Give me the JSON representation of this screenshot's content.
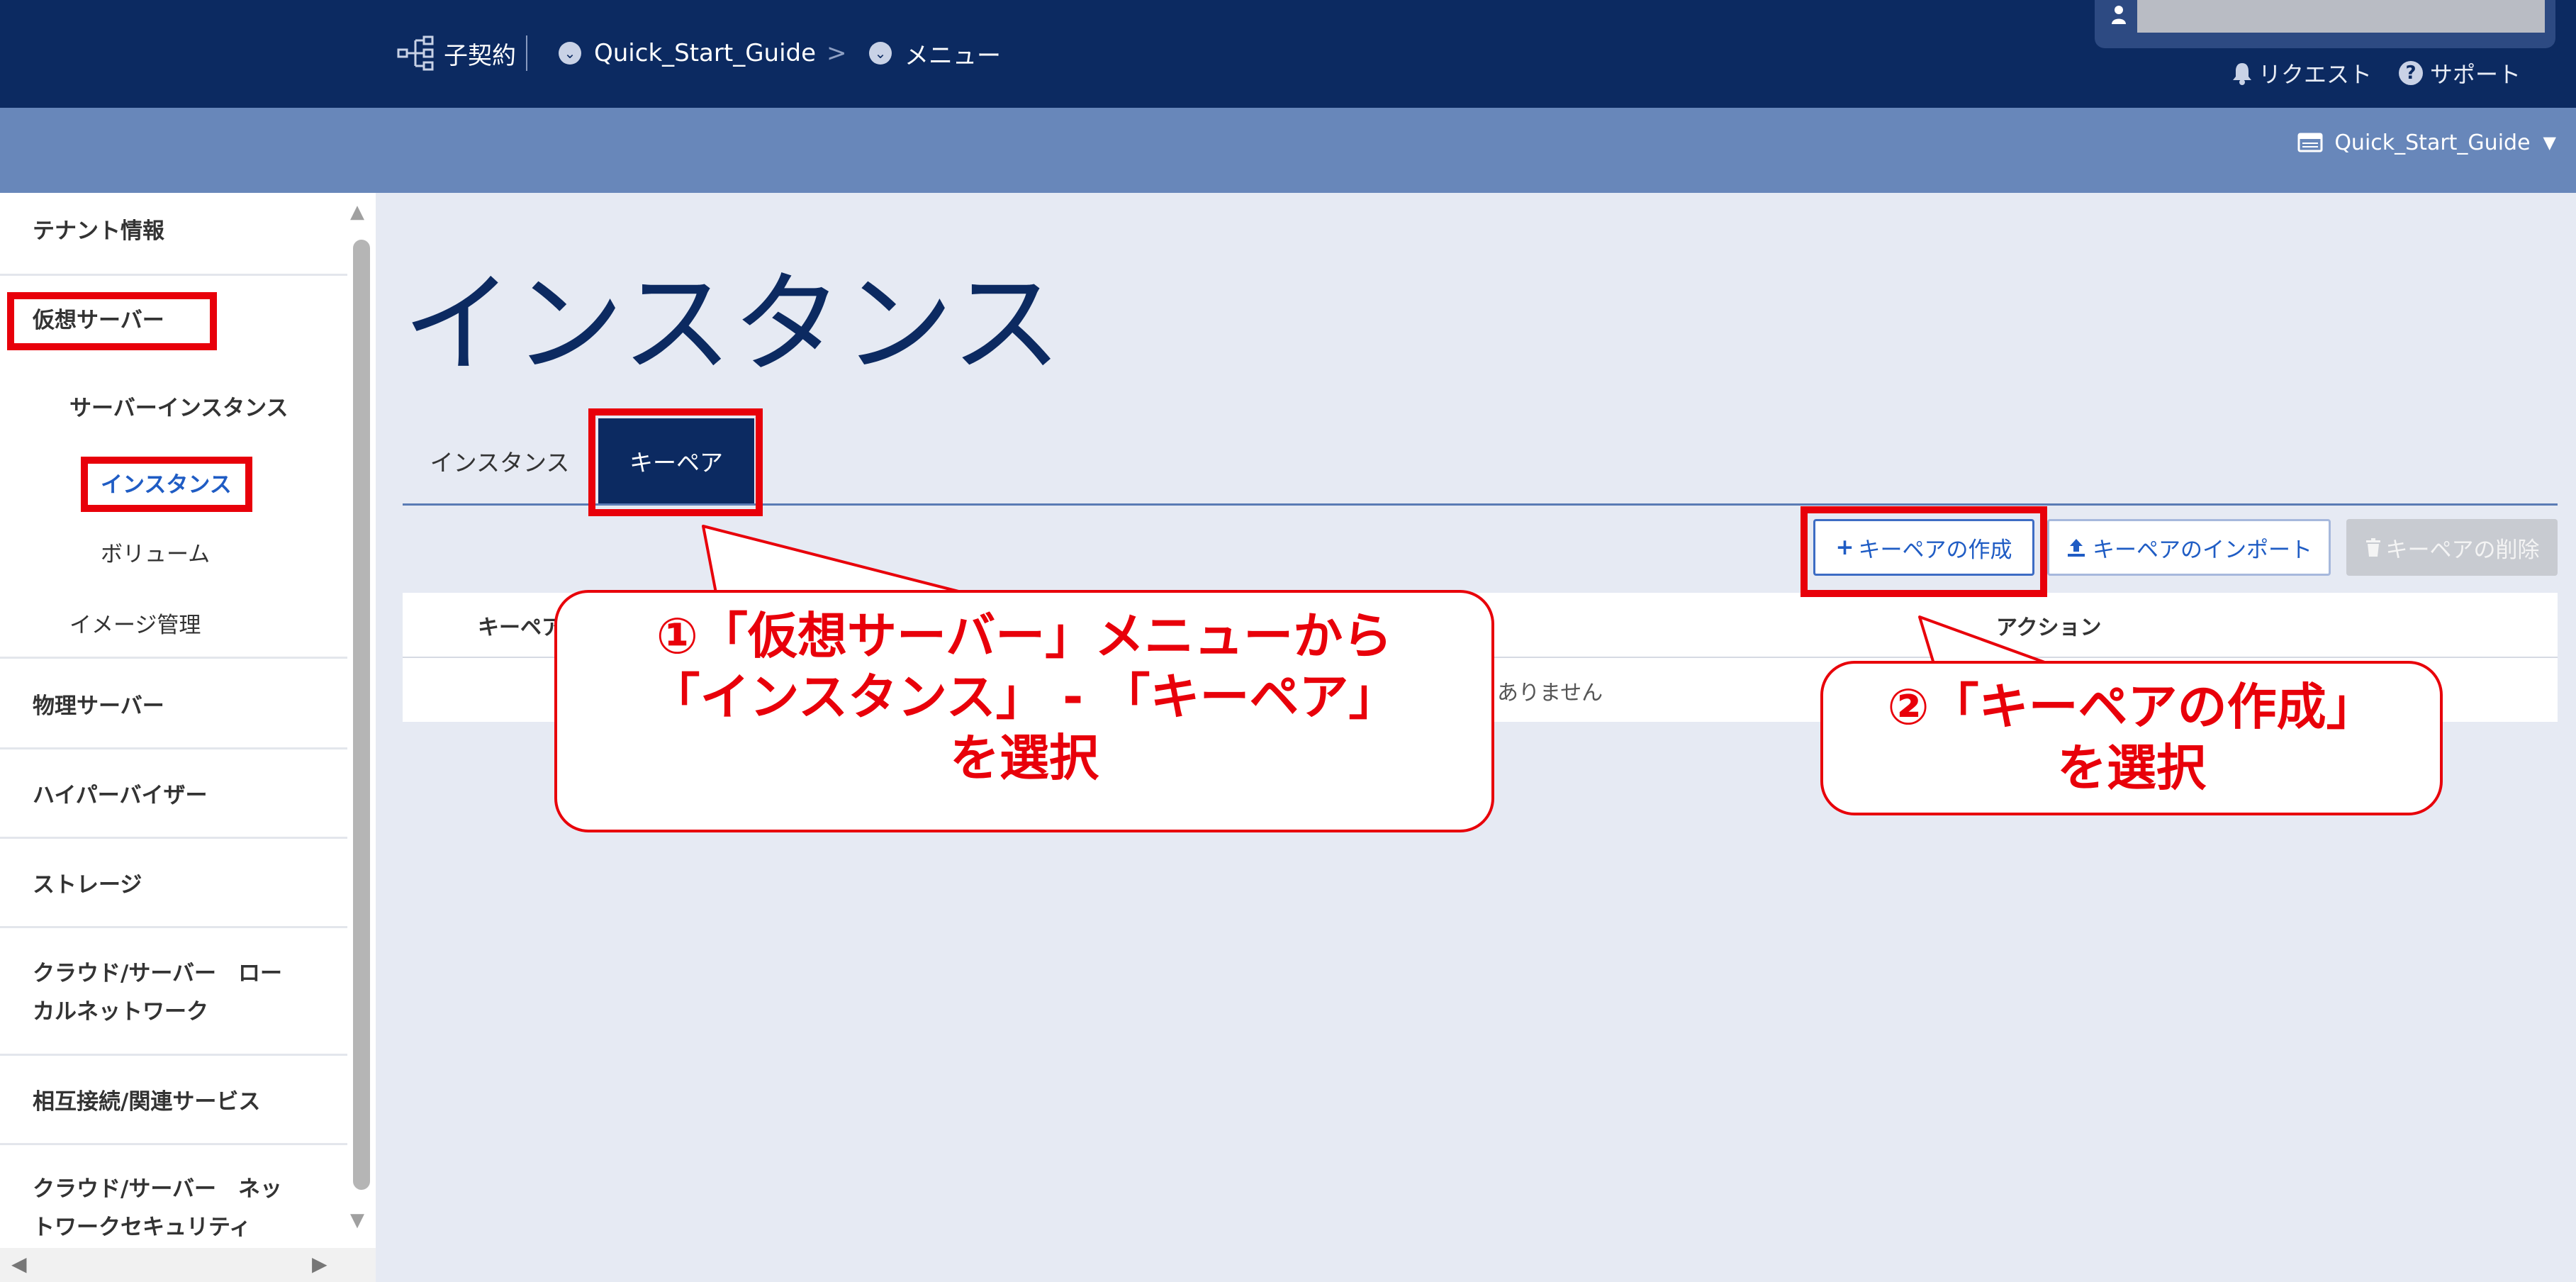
{
  "header": {
    "breadcrumb_contract": "子契約",
    "breadcrumb_project": "Quick_Start_Guide",
    "breadcrumb_separator": ">",
    "breadcrumb_menu": "メニュー",
    "request_label": "リクエスト",
    "support_label": "サポート"
  },
  "subheader": {
    "tenant_selector": "Quick_Start_Guide"
  },
  "sidebar": {
    "items": [
      {
        "label": "テナント情報"
      },
      {
        "label": "仮想サーバー"
      },
      {
        "label": "サーバーインスタンス"
      },
      {
        "label": "インスタンス"
      },
      {
        "label": "ボリューム"
      },
      {
        "label": "イメージ管理"
      },
      {
        "label": "物理サーバー"
      },
      {
        "label": "ハイパーバイザー"
      },
      {
        "label": "ストレージ"
      },
      {
        "label": "クラウド/サーバー　ローカルネットワーク"
      },
      {
        "label": "相互接続/関連サービス"
      },
      {
        "label": "クラウド/サーバー　ネットワークセキュリティ"
      }
    ]
  },
  "main": {
    "title": "インスタンス",
    "tabs": [
      {
        "label": "インスタンス"
      },
      {
        "label": "キーペア"
      }
    ],
    "buttons": {
      "create": "キーペアの作成",
      "import": "キーペアのインポート",
      "delete": "キーペアの削除"
    },
    "table": {
      "col_name": "キーペア",
      "col_action": "アクション",
      "empty_text": "ありません"
    }
  },
  "annotations": {
    "callout1_line1": "①「仮想サーバー」メニューから",
    "callout1_line2": "「インスタンス」 - 「キーペア」",
    "callout1_line3": "を選択",
    "callout2_line1": "②「キーペアの作成」",
    "callout2_line2": "を選択"
  },
  "colors": {
    "header": "#0c2a61",
    "subheader": "#6887ba",
    "accent": "#1f5cc4",
    "annotation_red": "#e8000a"
  }
}
